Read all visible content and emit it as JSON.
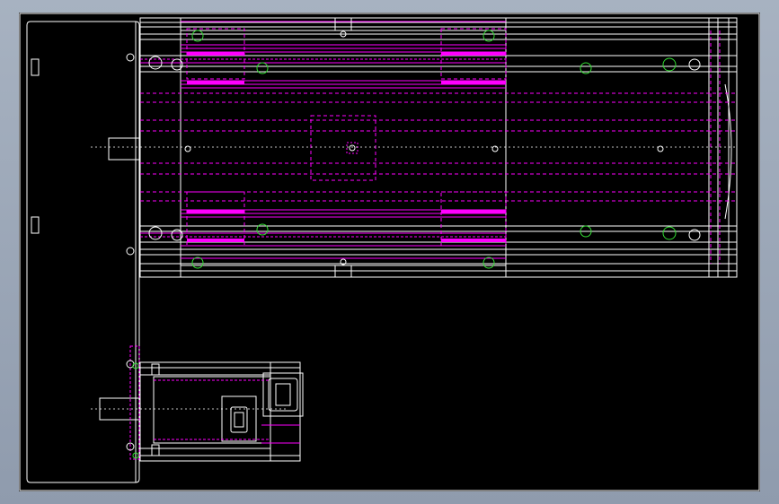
{
  "colors": {
    "background": "#000000",
    "viewport": "#9aa6b6",
    "outline": "#ffffff",
    "hidden_lines": "#ff00ff",
    "holes": "#33dd33"
  }
}
